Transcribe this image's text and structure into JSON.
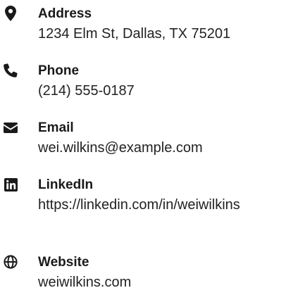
{
  "contact": {
    "items": [
      {
        "icon": "map-marker-icon",
        "label": "Address",
        "value": "1234 Elm St, Dallas, TX 75201"
      },
      {
        "icon": "phone-icon",
        "label": "Phone",
        "value": "(214) 555-0187"
      },
      {
        "icon": "envelope-icon",
        "label": "Email",
        "value": "wei.wilkins@example.com"
      },
      {
        "icon": "linkedin-icon",
        "label": "LinkedIn",
        "value": "https://linkedin.com/in/weiwilkins"
      },
      {
        "icon": "globe-icon",
        "label": "Website",
        "value": "weiwilkins.com"
      }
    ]
  }
}
